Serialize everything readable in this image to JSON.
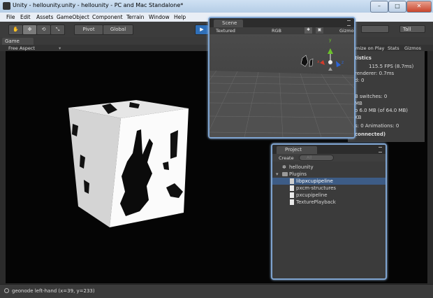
{
  "window": {
    "title": "Unity - hellounity.unity - hellounity - PC and Mac Standalone*",
    "min": "–",
    "max": "□",
    "close": "✕"
  },
  "menu": [
    "File",
    "Edit",
    "Assets",
    "GameObject",
    "Component",
    "Terrain",
    "Window",
    "Help"
  ],
  "toolbar": {
    "pivot": "Pivot",
    "global": "Global",
    "play": "▶",
    "layers": "",
    "layout": "Tall",
    "tools": [
      "✋",
      "✥",
      "⟲",
      "⤡"
    ]
  },
  "game": {
    "tab": "Game",
    "aspect": "Free Aspect",
    "maximize": "mize on Play",
    "stats": "Stats",
    "gizmos": "Gizmos"
  },
  "stats": {
    "title": "tistics",
    "fps": "115.5 FPS (8.7ms)",
    "renderer": "renderer: 0.7ms",
    "d": "d: 0",
    "batches": "B  switches: 0",
    "mb1": "MB",
    "vram": "o 6.0 MB (of 64.0 MB)",
    "kb": "KB",
    "anim": "s: 0     Animations: 0",
    "connected": "connected)"
  },
  "scene": {
    "tab": "Scene",
    "mode": "Textured",
    "rgb": "RGB",
    "gizmos": "Gizmo",
    "axes": {
      "y": "y",
      "x": "x",
      "z": "z"
    }
  },
  "project": {
    "tab": "Project",
    "create": "Create",
    "search_placeholder": "All",
    "items": [
      {
        "label": "hellounity",
        "indent": 0,
        "icon": "unity-scene-icon",
        "selected": false
      },
      {
        "label": "Plugins",
        "indent": 0,
        "icon": "folder-icon",
        "selected": false
      },
      {
        "label": "libpxcupipeline",
        "indent": 1,
        "icon": "file-icon",
        "selected": true
      },
      {
        "label": "pxcm-structures",
        "indent": 1,
        "icon": "script-icon",
        "selected": false
      },
      {
        "label": "pxcupipeline",
        "indent": 1,
        "icon": "script-icon",
        "selected": false
      },
      {
        "label": "TexturePlayback",
        "indent": 1,
        "icon": "script-icon",
        "selected": false
      }
    ]
  },
  "status": {
    "text": "geonode left-hand (x=39, y=233)"
  }
}
